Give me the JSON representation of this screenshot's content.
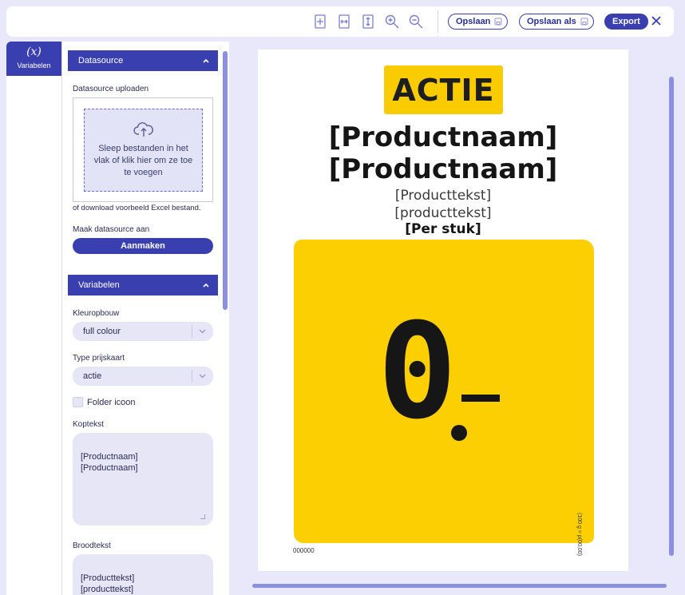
{
  "toolbar": {
    "icons": [
      "fit-page-icon",
      "fit-width-icon",
      "fit-height-icon",
      "zoom-in-icon",
      "zoom-out-icon"
    ],
    "save_label": "Opslaan",
    "save_as_label": "Opslaan als",
    "export_label": "Export"
  },
  "sidebar_tab": {
    "symbol": "(x)",
    "label": "Variabelen"
  },
  "datasource": {
    "section_title": "Datasource",
    "upload_label": "Datasource uploaden",
    "drop_text": "Sleep bestanden in het vlak of klik hier om ze toe te voegen",
    "download_text": "of download voorbeeld Excel bestand.",
    "create_label": "Maak datasource aan",
    "create_button": "Aanmaken"
  },
  "variables": {
    "section_title": "Variabelen",
    "color_label": "Kleuropbouw",
    "color_value": "full colour",
    "price_type_label": "Type prijskaart",
    "price_type_value": "actie",
    "folder_icon_label": "Folder icoon",
    "folder_icon_checked": false,
    "header_label": "Koptekst",
    "header_value": "[Productnaam]\n[Productnaam]",
    "body_label": "Broodtekst",
    "body_value": "[Producttekst]\n[producttekst]"
  },
  "preview": {
    "badge": "ACTIE",
    "headline_1": "[Productnaam]",
    "headline_2": "[Productnaam]",
    "text_1": "[Producttekst]",
    "text_2": "[producttekst]",
    "unit": "[Per stuk]",
    "price_whole": "0",
    "price_cents": "-",
    "code": "000000",
    "footnote": "(100 g = p(00,00)"
  },
  "colors": {
    "accent": "#3a3fb0",
    "price_yellow": "#fccf03",
    "background": "#e9e8fa"
  }
}
